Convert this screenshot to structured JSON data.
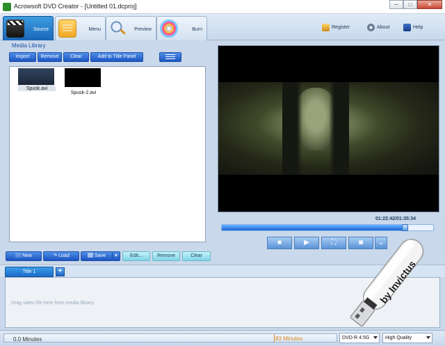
{
  "window": {
    "title": "Acrowsoft DVD Creator - [Untitled 01.dcproj]"
  },
  "tabs": [
    {
      "label": "Source",
      "icon": "clapperboard-icon",
      "active": true
    },
    {
      "label": "Menu",
      "icon": "menu-notepad-icon",
      "active": false
    },
    {
      "label": "Preview",
      "icon": "magnifier-icon",
      "active": false
    },
    {
      "label": "Burn",
      "icon": "disc-icon",
      "active": false
    }
  ],
  "topright": {
    "register": "Register",
    "about": "About",
    "help": "Help"
  },
  "media_library": {
    "title": "Media Library",
    "buttons": {
      "import": "Import",
      "remove": "Remove",
      "clear": "Clear",
      "add_to_title_panel": "Add to Title Panel"
    },
    "items": [
      {
        "name": "Spusk.avi",
        "selected": true
      },
      {
        "name": "Spusk-2.avi",
        "selected": false
      }
    ]
  },
  "project_buttons": {
    "new": "New",
    "load": "Load",
    "save": "Save",
    "edit": "Edit...",
    "remove": "Remove",
    "clear": "Clear"
  },
  "player": {
    "time": "01:22:42/01:35:34",
    "progress_fraction": 0.866
  },
  "titles": {
    "tab_label": "Title 1",
    "add": "+",
    "drop_hint": "Drag video file here from media library."
  },
  "status": {
    "minutes": "0.0 Minutes",
    "limit_marker": "83 Minutes",
    "disc_type": "DVD-R 4.5G",
    "quality": "High Quality"
  },
  "watermark": {
    "text": "by Invictus"
  },
  "colors": {
    "accent": "#1d55c2",
    "light_button": "#7fd4e6",
    "background": "#c9d8ea"
  }
}
